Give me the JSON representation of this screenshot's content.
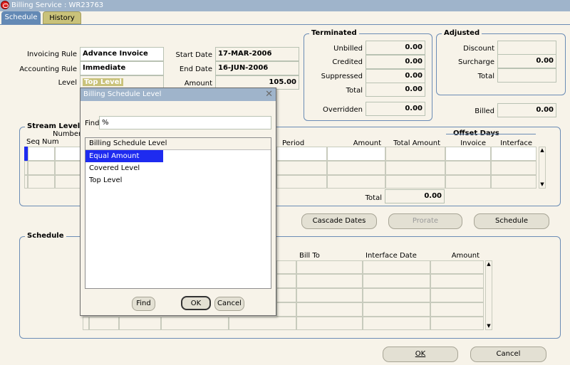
{
  "window": {
    "title": "Billing Service : WR23763"
  },
  "tabs": [
    {
      "label": "Schedule"
    },
    {
      "label": "History"
    }
  ],
  "header": {
    "invoicing_rule_label": "Invoicing Rule",
    "invoicing_rule_value": "Advance Invoice",
    "accounting_rule_label": "Accounting Rule",
    "accounting_rule_value": "Immediate",
    "level_label": "Level",
    "level_value": "Top Level",
    "start_date_label": "Start Date",
    "start_date_value": "17-MAR-2006",
    "end_date_label": "End Date",
    "end_date_value": "16-JUN-2006",
    "amount_label": "Amount",
    "amount_value": "105.00"
  },
  "terminated": {
    "title": "Terminated",
    "unbilled_label": "Unbilled",
    "unbilled_value": "0.00",
    "credited_label": "Credited",
    "credited_value": "0.00",
    "suppressed_label": "Suppressed",
    "suppressed_value": "0.00",
    "total_label": "Total",
    "total_value": "0.00",
    "overridden_label": "Overridden",
    "overridden_value": "0.00"
  },
  "adjusted": {
    "title": "Adjusted",
    "discount_label": "Discount",
    "discount_value": "",
    "surcharge_label": "Surcharge",
    "surcharge_value": "0.00",
    "total_label": "Total",
    "total_value": ""
  },
  "billed": {
    "label": "Billed",
    "value": "0.00"
  },
  "stream_level": {
    "title": "Stream Level",
    "col_number": "Number",
    "col_seq": "Seq Num",
    "col_period": "Period",
    "col_amount": "Amount",
    "col_total_amount": "Total Amount",
    "offset_days_title": "Offset Days",
    "col_invoice": "Invoice",
    "col_interface": "Interface",
    "total_label": "Total",
    "total_value": "0.00"
  },
  "buttons": {
    "cascade_dates": "Cascade Dates",
    "prorate": "Prorate",
    "schedule": "Schedule",
    "ok": "OK",
    "cancel": "Cancel"
  },
  "schedule": {
    "title": "Schedule",
    "col_bill_to": "Bill To",
    "col_interface_date": "Interface Date",
    "col_amount": "Amount"
  },
  "dialog": {
    "title": "Billing Schedule Level",
    "find_label": "Find",
    "find_value": "%",
    "list_header": "Billing Schedule Level",
    "items": [
      {
        "label": "Equal Amount",
        "selected": true
      },
      {
        "label": "Covered Level",
        "selected": false
      },
      {
        "label": "Top Level",
        "selected": false
      }
    ],
    "find_button": "Find",
    "ok_button": "OK",
    "cancel_button": "Cancel"
  },
  "colors": {
    "titlebar": "#9fb4cb",
    "accent": "#6389b5",
    "selection": "#1e2bf0",
    "background": "#f7f3e9"
  }
}
